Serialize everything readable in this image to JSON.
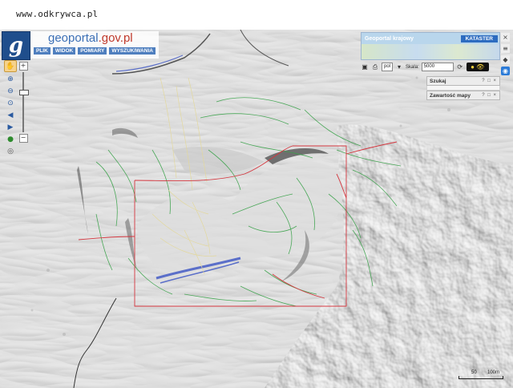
{
  "watermark": "www.odkrywca.pl",
  "logo": {
    "letter": "g",
    "text_geo": "geo",
    "text_portal": "portal",
    "text_domain": ".gov.pl"
  },
  "menu": [
    "PLIK",
    "WIDOK",
    "POMIARY",
    "WYSZUKIWANIA"
  ],
  "tools": [
    "hand-icon",
    "zoom-in-icon",
    "zoom-out-icon",
    "zoom-box-icon",
    "prev-view-icon",
    "next-view-icon",
    "info-icon",
    "full-extent-icon"
  ],
  "zoom": {
    "plus": "+",
    "minus": "−"
  },
  "overview": {
    "title": "Geoportal krajowy",
    "badge": "KATASTER"
  },
  "toolbar": {
    "lang": "pol",
    "scale_label": "Skala:",
    "scale_value": "5000"
  },
  "panels": {
    "search": "Szukaj",
    "contents": "Zawartość mapy",
    "controls": "? □ ×"
  },
  "scalebar": {
    "mid": "50",
    "end": "100m"
  },
  "colors": {
    "brand_blue": "#1f4e8c",
    "menu_blue": "#4f7fbf",
    "red_line": "#d4373f",
    "green_paths": "#3aa24a",
    "yellow_paths": "#e3d89a",
    "water_blue": "#5b6fc9"
  }
}
